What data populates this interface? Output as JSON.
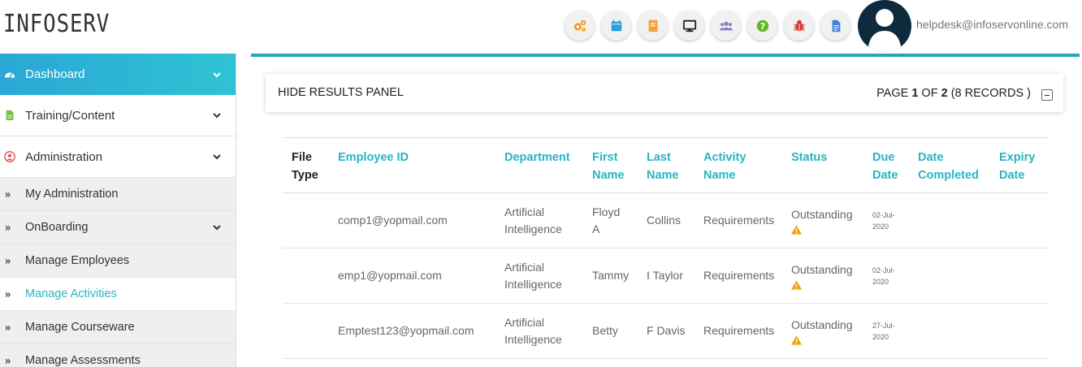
{
  "header": {
    "logo": "INFOSERV",
    "icons": [
      "settings-cogs-icon",
      "calendar-icon",
      "book-icon",
      "monitor-icon",
      "users-icon",
      "help-icon",
      "bug-icon",
      "document-icon"
    ],
    "email": "helpdesk@infoservonline.com"
  },
  "sidebar": {
    "items": [
      {
        "label": "Dashboard",
        "icon": "dashboard-icon"
      },
      {
        "label": "Training/Content",
        "icon": "file-icon"
      },
      {
        "label": "Administration",
        "icon": "user-circle-icon"
      },
      {
        "label": "My Administration"
      },
      {
        "label": "OnBoarding"
      },
      {
        "label": "Manage Employees"
      },
      {
        "label": "Manage Activities"
      },
      {
        "label": "Manage Courseware"
      },
      {
        "label": "Manage Assessments"
      }
    ]
  },
  "panel": {
    "title": "HIDE RESULTS PANEL",
    "page_prefix": "PAGE",
    "page_current": "1",
    "page_of": "OF",
    "page_total": "2",
    "records": "(8 RECORDS )"
  },
  "table": {
    "headers": {
      "file_type": [
        "File",
        "Type"
      ],
      "employee_id": "Employee ID",
      "department": "Department",
      "first_name": [
        "First",
        "Name"
      ],
      "last_name": [
        "Last",
        "Name"
      ],
      "activity_name": [
        "Activity",
        "Name"
      ],
      "status": "Status",
      "due_date": [
        "Due",
        "Date"
      ],
      "date_completed": [
        "Date",
        "Completed"
      ],
      "expiry_date": [
        "Expiry",
        "Date"
      ]
    },
    "rows": [
      {
        "employee_id": "comp1@yopmail.com",
        "department": [
          "Artificial",
          "Intelligence"
        ],
        "first_name": [
          "Floyd",
          "A"
        ],
        "last_name": "Collins",
        "activity_name": "Requirements",
        "status": "Outstanding",
        "due_date": [
          "02-Jul-",
          "2020"
        ]
      },
      {
        "employee_id": "emp1@yopmail.com",
        "department": [
          "Artificial",
          "Intelligence"
        ],
        "first_name": [
          "Tammy"
        ],
        "last_name": "I Taylor",
        "activity_name": "Requirements",
        "status": "Outstanding",
        "due_date": [
          "02-Jul-",
          "2020"
        ]
      },
      {
        "employee_id": "Emptest123@yopmail.com",
        "department": [
          "Artificial",
          "Intelligence"
        ],
        "first_name": [
          "Betty"
        ],
        "last_name": "F Davis",
        "activity_name": "Requirements",
        "status": "Outstanding",
        "due_date": [
          "27-Jul-",
          "2020"
        ]
      }
    ]
  },
  "colors": {
    "accent": "#28b4c4",
    "sidebar_gradient_start": "#2aa8d6",
    "sidebar_gradient_end": "#2ec3d4",
    "warning": "#f0a500"
  }
}
